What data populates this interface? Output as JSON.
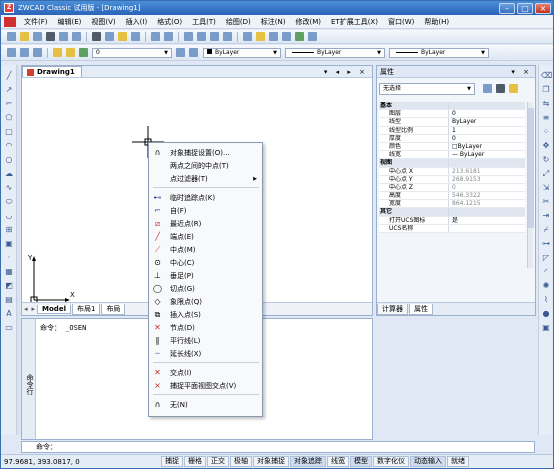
{
  "titlebar": {
    "title": "ZWCAD Classic 试用版 - [Drawing1]",
    "min": "–",
    "max": "□",
    "close": "×"
  },
  "menu": [
    "文件(F)",
    "编辑(E)",
    "视图(V)",
    "插入(I)",
    "格式(O)",
    "工具(T)",
    "绘图(D)",
    "标注(N)",
    "修改(M)",
    "ET扩展工具(X)",
    "窗口(W)",
    "帮助(H)"
  ],
  "toolbar2": {
    "color": "ByLayer",
    "linetype": "ByLayer",
    "lineweight": "ByLayer"
  },
  "document": {
    "tab": "Drawing1",
    "controls": "▾ ◂ ▸ ×"
  },
  "layout_tabs": [
    "Model",
    "布局1",
    "布局"
  ],
  "layout_nav": [
    "◂",
    "▸"
  ],
  "axes": {
    "x": "X",
    "y": "Y"
  },
  "command": {
    "side": "命令行",
    "history_prompt": "命令：",
    "history_cmd": "_OSEN",
    "input_prompt": "命令："
  },
  "properties": {
    "title": "属性",
    "controls": "▾ ×",
    "selection": "无选择",
    "categories": {
      "basic": "基本",
      "view": "视图",
      "other": "其它"
    },
    "basic_rows": [
      {
        "k": "图层",
        "v": "0"
      },
      {
        "k": "线型",
        "v": "ByLayer"
      },
      {
        "k": "线型比例",
        "v": "1"
      },
      {
        "k": "厚度",
        "v": "0"
      },
      {
        "k": "颜色",
        "v": "□ByLayer"
      },
      {
        "k": "线宽",
        "v": "— ByLayer"
      }
    ],
    "view_rows": [
      {
        "k": "中心点 X",
        "v": "213.6181"
      },
      {
        "k": "中心点 Y",
        "v": "268.9153"
      },
      {
        "k": "中心点 Z",
        "v": "0"
      },
      {
        "k": "高度",
        "v": "546.3322"
      },
      {
        "k": "宽度",
        "v": "864.1215"
      }
    ],
    "other_rows": [
      {
        "k": "打开UCS图标",
        "v": "是"
      },
      {
        "k": "UCS名称",
        "v": ""
      }
    ],
    "tabs": [
      "计算器",
      "属性"
    ]
  },
  "context_menu": {
    "top": [
      {
        "label": "对象捕捉设置(O)...",
        "icon": "magnet-icon"
      },
      {
        "label": "两点之间的中点(T)",
        "icon": ""
      },
      {
        "label": "点过滤器(T)",
        "icon": "",
        "submenu": true
      }
    ],
    "snaps": [
      {
        "label": "临时追踪点(K)",
        "icon": "tracking-icon"
      },
      {
        "label": "自(F)",
        "icon": "from-icon"
      },
      {
        "label": "最近点(R)",
        "icon": "nearest-icon"
      },
      {
        "label": "端点(E)",
        "icon": "endpoint-icon"
      },
      {
        "label": "中点(M)",
        "icon": "midpoint-icon"
      },
      {
        "label": "中心(C)",
        "icon": "center-icon"
      },
      {
        "label": "垂足(P)",
        "icon": "perpendicular-icon"
      },
      {
        "label": "切点(G)",
        "icon": "tangent-icon"
      },
      {
        "label": "象限点(Q)",
        "icon": "quadrant-icon"
      },
      {
        "label": "插入点(S)",
        "icon": "insertion-icon"
      },
      {
        "label": "节点(D)",
        "icon": "node-icon"
      },
      {
        "label": "平行线(L)",
        "icon": "parallel-icon"
      },
      {
        "label": "延长线(X)",
        "icon": "extension-icon"
      }
    ],
    "bottom": [
      {
        "label": "交点(I)",
        "icon": "intersection-icon"
      },
      {
        "label": "捕捉平面视图交点(V)",
        "icon": "apparent-intersection-icon"
      }
    ],
    "last": [
      {
        "label": "无(N)",
        "icon": "none-icon"
      }
    ]
  },
  "status": {
    "coords": "97.9681, 393.0817, 0",
    "toggles": [
      {
        "label": "捕捉",
        "on": false
      },
      {
        "label": "栅格",
        "on": false
      },
      {
        "label": "正交",
        "on": false
      },
      {
        "label": "极轴",
        "on": false
      },
      {
        "label": "对象捕捉",
        "on": false
      },
      {
        "label": "对象追踪",
        "on": true
      },
      {
        "label": "线宽",
        "on": false
      },
      {
        "label": "模型",
        "on": true
      },
      {
        "label": "数字化仪",
        "on": false
      },
      {
        "label": "动态输入",
        "on": true
      },
      {
        "label": "就绪",
        "on": false
      }
    ]
  }
}
